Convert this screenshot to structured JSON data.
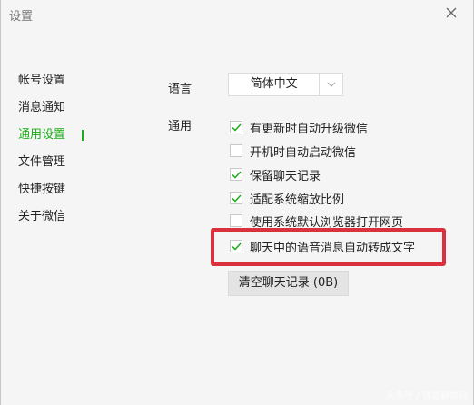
{
  "window": {
    "title": "设置"
  },
  "sidebar": {
    "items": [
      {
        "label": "帐号设置",
        "active": false
      },
      {
        "label": "消息通知",
        "active": false
      },
      {
        "label": "通用设置",
        "active": true
      },
      {
        "label": "文件管理",
        "active": false
      },
      {
        "label": "快捷按键",
        "active": false
      },
      {
        "label": "关于微信",
        "active": false
      }
    ]
  },
  "language": {
    "label": "语言",
    "selected": "简体中文"
  },
  "general": {
    "label": "通用",
    "options": [
      {
        "label": "有更新时自动升级微信",
        "checked": true
      },
      {
        "label": "开机时自动启动微信",
        "checked": false
      },
      {
        "label": "保留聊天记录",
        "checked": true
      },
      {
        "label": "适配系统缩放比例",
        "checked": true
      },
      {
        "label": "使用系统默认浏览器打开网页",
        "checked": false
      },
      {
        "label": "聊天中的语音消息自动转成文字",
        "checked": true
      }
    ],
    "clear_button": "清空聊天记录 (0B)"
  },
  "watermark": "头条号 / 钱哥聊数码",
  "colors": {
    "accent": "#1aad19",
    "highlight": "#d9323e"
  },
  "icons": {
    "close": "close-icon",
    "dropdown": "chevron-down-icon",
    "check": "check-icon"
  }
}
